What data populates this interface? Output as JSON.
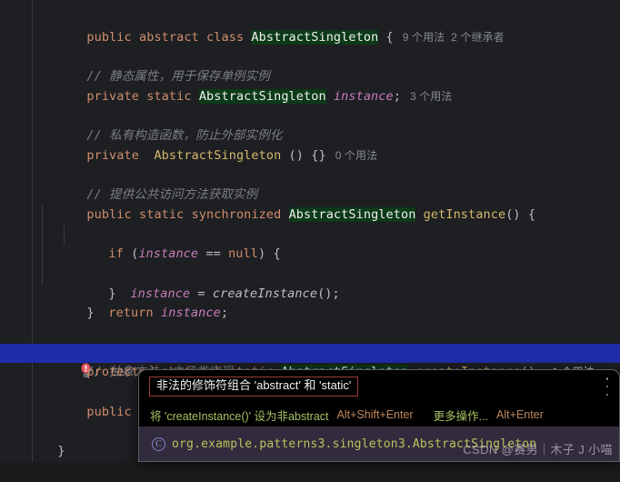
{
  "editor": {
    "theme_bg": "#1e1f22",
    "selection_bg": "#1f2da8",
    "type_highlight_bg": "#0c3a17",
    "keyword_color": "#cf8e6d",
    "comment_color": "#7a7e85",
    "field_color": "#c77dbb",
    "method_color": "#d6b86c",
    "gutter_error_icon": "error-bulb-icon",
    "lines": [
      {
        "n": 1,
        "tokens": [
          {
            "t": "public",
            "c": "kw"
          },
          {
            "t": " ",
            "c": "plain"
          },
          {
            "t": "abstract",
            "c": "kw"
          },
          {
            "t": " ",
            "c": "plain"
          },
          {
            "t": "class",
            "c": "kw"
          },
          {
            "t": " ",
            "c": "plain"
          },
          {
            "t": "AbstractSingleton",
            "c": "type-hl"
          },
          {
            "t": " {",
            "c": "plain"
          }
        ],
        "hint": "9 个用法  2 个继承者"
      },
      {
        "n": 2,
        "tokens": [],
        "hint": ""
      },
      {
        "n": 3,
        "tokens": [
          {
            "t": "// 静态属性，用于保存单例实例",
            "c": "cmt"
          }
        ],
        "hint": ""
      },
      {
        "n": 4,
        "tokens": [
          {
            "t": "private",
            "c": "kw"
          },
          {
            "t": " ",
            "c": "plain"
          },
          {
            "t": "static",
            "c": "kw"
          },
          {
            "t": " ",
            "c": "plain"
          },
          {
            "t": "AbstractSingleton",
            "c": "type-hl"
          },
          {
            "t": " ",
            "c": "plain"
          },
          {
            "t": "instance",
            "c": "fld"
          },
          {
            "t": ";",
            "c": "plain"
          }
        ],
        "hint": "3 个用法"
      },
      {
        "n": 5,
        "tokens": [],
        "hint": ""
      },
      {
        "n": 6,
        "tokens": [
          {
            "t": "// 私有构造函数，防止外部实例化",
            "c": "cmt"
          }
        ],
        "hint": ""
      },
      {
        "n": 7,
        "tokens": [
          {
            "t": "private",
            "c": "kw"
          },
          {
            "t": "  ",
            "c": "plain"
          },
          {
            "t": "AbstractSingleton",
            "c": "type-y"
          },
          {
            "t": " () {}",
            "c": "plain"
          }
        ],
        "hint": "0 个用法"
      },
      {
        "n": 8,
        "tokens": [],
        "hint": ""
      },
      {
        "n": 9,
        "tokens": [
          {
            "t": "// 提供公共访问方法获取实例",
            "c": "cmt"
          }
        ],
        "hint": ""
      },
      {
        "n": 10,
        "tokens": [
          {
            "t": "public",
            "c": "kw"
          },
          {
            "t": " ",
            "c": "plain"
          },
          {
            "t": "static",
            "c": "kw"
          },
          {
            "t": " ",
            "c": "plain"
          },
          {
            "t": "synchronized",
            "c": "kw"
          },
          {
            "t": " ",
            "c": "plain"
          },
          {
            "t": "AbstractSingleton",
            "c": "type-hl"
          },
          {
            "t": " ",
            "c": "plain"
          },
          {
            "t": "getInstance",
            "c": "meth"
          },
          {
            "t": "() {",
            "c": "plain"
          }
        ],
        "hint": ""
      }
    ],
    "highlighted_line_code": "protected abstract static AbstractSingleton createInstance();",
    "highlighted_line_hint": "1 个用法",
    "partial_last_line": "public abstra",
    "closing_brace": "}"
  },
  "tooltip": {
    "message": "非法的修饰符组合 'abstract' 和 'static'",
    "message_border_color": "#9c3b3b",
    "kebab_icon": "more-options-icon",
    "action_primary": "将 'createInstance()' 设为非abstract",
    "action_primary_shortcut": "Alt+Shift+Enter",
    "action_secondary": "更多操作...",
    "action_secondary_shortcut": "Alt+Enter",
    "class_icon": "class-c-icon",
    "fqn": "org.example.patterns3.singleton3.AbstractSingleton",
    "fqn_color": "#b9c45c",
    "footer_bg": "#322a3d"
  },
  "watermark": {
    "text": "CSDN @赛男｜木子 J 小喵"
  }
}
